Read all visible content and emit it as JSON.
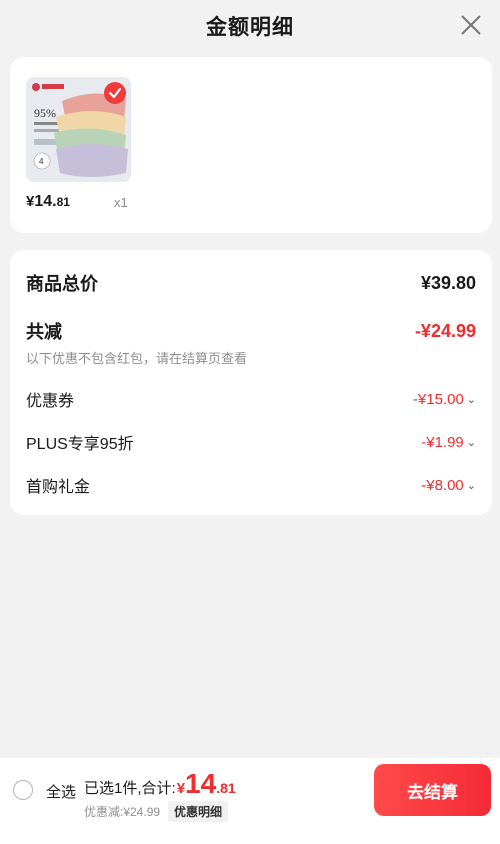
{
  "header": {
    "title": "金额明细"
  },
  "product": {
    "image_brand": "洁丽雅",
    "image_percent": "95%",
    "price_currency": "¥",
    "price_int": "14.",
    "price_dec": "81",
    "quantity": "x1",
    "selected": true
  },
  "summary": {
    "total_label": "商品总价",
    "total_value": "¥39.80",
    "reduce_label": "共减",
    "reduce_value": "-¥24.99",
    "note": "以下优惠不包含红包，请在结算页查看",
    "items": [
      {
        "label": "优惠券",
        "value": "-¥15.00"
      },
      {
        "label": "PLUS专享95折",
        "value": "-¥1.99"
      },
      {
        "label": "首购礼金",
        "value": "-¥8.00"
      }
    ]
  },
  "bottom": {
    "select_all": "全选",
    "selected_label": "已选1件,合计:",
    "currency": "¥",
    "total_int": "14",
    "total_dec": ".81",
    "discount_text": "优惠减:¥24.99",
    "detail_button": "优惠明细",
    "checkout": "去结算"
  },
  "colors": {
    "accent": "#ef2d2d",
    "checkout_start": "#ff4a4a",
    "checkout_end": "#f42a36"
  }
}
